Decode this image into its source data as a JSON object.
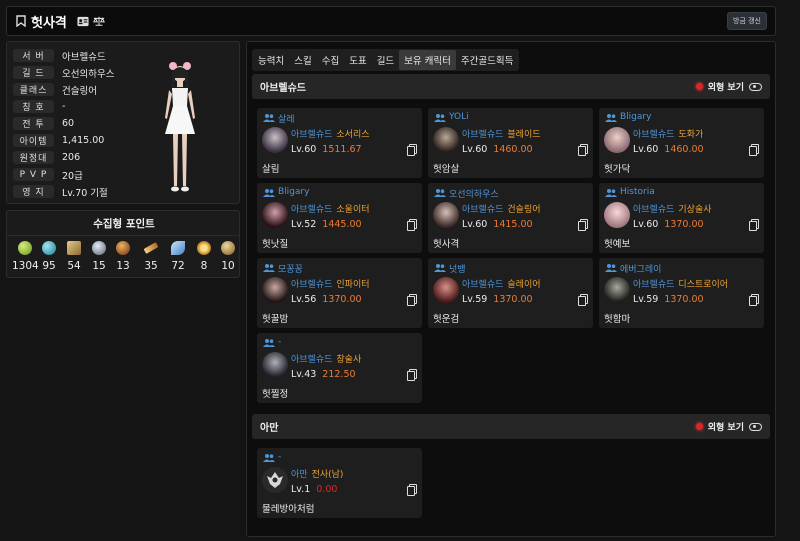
{
  "header": {
    "title": "헛사격",
    "refresh_label": "방금 갱신"
  },
  "profile": {
    "rows": [
      {
        "label": "서 버",
        "value": "아브렐슈드"
      },
      {
        "label": "길 드",
        "value": "오선의하우스"
      },
      {
        "label": "클래스",
        "value": "건슬링어"
      },
      {
        "label": "칭 호",
        "value": "-"
      },
      {
        "label": "전 투",
        "value": "60"
      },
      {
        "label": "아이템",
        "value": "1,415.00"
      },
      {
        "label": "원정대",
        "value": "206"
      },
      {
        "label": "P V P",
        "value": "20급"
      },
      {
        "label": "영 지",
        "value": "Lv.70 기절"
      }
    ]
  },
  "points": {
    "title": "수집형 포인트",
    "items": [
      {
        "icon": "mokoko-seed-icon",
        "value": "1304",
        "color": "#9bc43a"
      },
      {
        "icon": "island-heart-icon",
        "value": "95",
        "color": "#3fb6c9"
      },
      {
        "icon": "art-icon",
        "value": "54",
        "color": "#c9a45a"
      },
      {
        "icon": "giant-heart-icon",
        "value": "15",
        "color": "#b0b8c8"
      },
      {
        "icon": "ignea-token-icon",
        "value": "13",
        "color": "#c08a3a"
      },
      {
        "icon": "sea-bounty-icon",
        "value": "35",
        "color": "#d9a040"
      },
      {
        "icon": "world-tree-leaf-icon",
        "value": "72",
        "color": "#7fb0e0"
      },
      {
        "icon": "orpheus-star-icon",
        "value": "8",
        "color": "#e0a030"
      },
      {
        "icon": "omnium-star-icon",
        "value": "10",
        "color": "#c8a060"
      }
    ]
  },
  "tabs": [
    {
      "label": "능력치",
      "active": false
    },
    {
      "label": "스킬",
      "active": false
    },
    {
      "label": "수집",
      "active": false
    },
    {
      "label": "도표",
      "active": false
    },
    {
      "label": "길드",
      "active": false
    },
    {
      "label": "보유 캐릭터",
      "active": true
    },
    {
      "label": "주간골드획득",
      "active": false
    }
  ],
  "sections": [
    {
      "title": "아브렐슈드",
      "look_label": "외형 보기",
      "characters": [
        {
          "tag": "살레",
          "server": "아브렐슈드",
          "klass": "소서리스",
          "level": "Lv.60",
          "ilvl": "1511.67",
          "name": "살림"
        },
        {
          "tag": "YOLi",
          "server": "아브렐슈드",
          "klass": "블레이드",
          "level": "Lv.60",
          "ilvl": "1460.00",
          "name": "헛암살"
        },
        {
          "tag": "Bligary",
          "server": "아브렐슈드",
          "klass": "도화가",
          "level": "Lv.60",
          "ilvl": "1460.00",
          "name": "헛가닥"
        },
        {
          "tag": "Bligary",
          "server": "아브렐슈드",
          "klass": "소울이터",
          "level": "Lv.52",
          "ilvl": "1445.00",
          "name": "헛낫질"
        },
        {
          "tag": "오선의하우스",
          "server": "아브렐슈드",
          "klass": "건슬링어",
          "level": "Lv.60",
          "ilvl": "1415.00",
          "name": "헛사격"
        },
        {
          "tag": "Historia",
          "server": "아브렐슈드",
          "klass": "기상술사",
          "level": "Lv.60",
          "ilvl": "1370.00",
          "name": "헛예보"
        },
        {
          "tag": "모꽁꽁",
          "server": "아브렐슈드",
          "klass": "인파이터",
          "level": "Lv.56",
          "ilvl": "1370.00",
          "name": "헛꿀밤"
        },
        {
          "tag": "넛뱅",
          "server": "아브렐슈드",
          "klass": "슬레이어",
          "level": "Lv.59",
          "ilvl": "1370.00",
          "name": "헛운검"
        },
        {
          "tag": "에버그레이",
          "server": "아브렐슈드",
          "klass": "디스트로이어",
          "level": "Lv.59",
          "ilvl": "1370.00",
          "name": "헛함마"
        },
        {
          "tag": "-",
          "server": "아브렐슈드",
          "klass": "창술사",
          "level": "Lv.43",
          "ilvl": "212.50",
          "name": "헛찔정"
        }
      ]
    },
    {
      "title": "아만",
      "look_label": "외형 보기",
      "characters": [
        {
          "tag": "-",
          "server": "아만",
          "klass": "전사(남)",
          "level": "Lv.1",
          "ilvl": "0.00",
          "name": "물레방아처럼"
        }
      ]
    }
  ],
  "colors": {
    "server_blue": "#4f95d9",
    "class_orange": "#f0a330",
    "ilvl_orange": "#f07a30",
    "look_dot_red": "#e02424"
  }
}
